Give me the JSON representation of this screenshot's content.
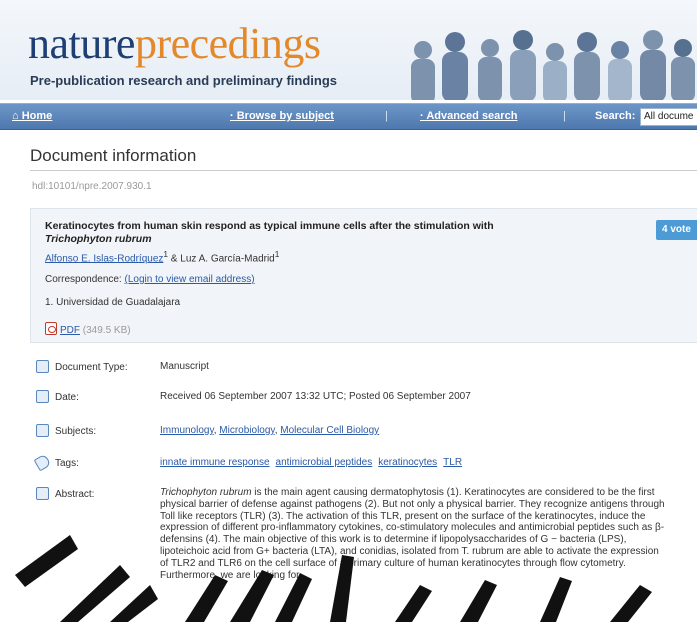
{
  "header": {
    "brand_part1": "nature",
    "brand_part2": "precedings",
    "tagline": "Pre-publication research and preliminary findings"
  },
  "nav": {
    "home": "Home",
    "browse": "Browse by subject",
    "advanced": "Advanced search",
    "search_label": "Search:",
    "search_value": "All docume",
    "separator": "|"
  },
  "page": {
    "title": "Document information",
    "hdl": "hdl:10101/npre.2007.930.1"
  },
  "document": {
    "title_text": "Keratinocytes from human skin respond as typical immune cells after the stimulation with",
    "title_species": "Trichophyton rubrum",
    "author1": "Alfonso E. Islas-Rodríquez",
    "author1_sup": "1",
    "author_join": " & ",
    "author2": "Luz A. García-Madrid",
    "author2_sup": "1",
    "correspondence_label": "Correspondence:",
    "correspondence_link": "(Login to view email address)",
    "affiliation": "1.  Universidad de Guadalajara",
    "pdf_label": "PDF",
    "pdf_size": "(349.5 KB)",
    "votes": "4 vote"
  },
  "fields": {
    "type_label": "Document Type:",
    "type_value": "Manuscript",
    "date_label": "Date:",
    "date_value": "Received 06 September 2007 13:32 UTC; Posted 06 September 2007",
    "subjects_label": "Subjects:",
    "subjects": [
      "Immunology",
      "Microbiology",
      "Molecular Cell Biology"
    ],
    "tags_label": "Tags:",
    "tags": [
      "innate immune response",
      "antimicrobial peptides",
      "keratinocytes",
      "TLR"
    ],
    "abstract_label": "Abstract:"
  },
  "abstract": {
    "species": "Trichophyton rubrum",
    "text": " is the main agent causing dermatophytosis (1). Keratinocytes are considered to be the first physical barrier of defense against pathogens (2). But not only a physical barrier. They recognize antigens through Toll like receptors (TLR) (3). The activation of this TLR, present on the surface of the keratinocytes, induce the expression of different pro-inflammatory cytokines, co-stimulatory molecules and antimicrobial peptides such as β-defensins (4). The main objective of this work is to determine if lipopolysaccharides of G − bacteria (LPS), lipoteichoic acid from G+ bacteria (LTA), and conidias, isolated from T. rubrum are able to activate the expression of TLR2 and TLR6 on the cell surface of a primary culture of human keratinocytes through flow cytometry. Furthermore, we are looking for"
  },
  "colors": {
    "brand_blue": "#1d3f73",
    "brand_orange": "#e3892b",
    "nav_bar": "#5b85ba",
    "link": "#2a5aa8",
    "panel_bg": "#f1f4f8",
    "vote_badge": "#4c9bd6"
  }
}
